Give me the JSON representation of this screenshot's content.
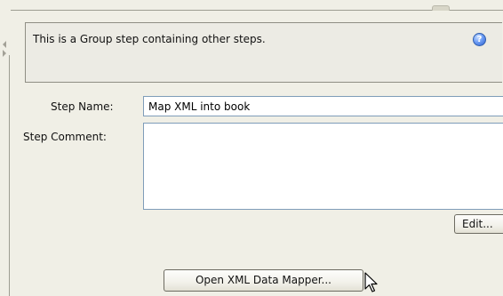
{
  "info_box": {
    "text": "This is a Group step containing other steps.",
    "help_icon_glyph": "?"
  },
  "form": {
    "step_name_label": "Step Name:",
    "step_name_value": "Map XML into book",
    "step_comment_label": "Step Comment:",
    "step_comment_value": ""
  },
  "buttons": {
    "edit_label": "Edit...",
    "open_mapper_label": "Open XML Data Mapper..."
  },
  "icons": {
    "help": "help-icon",
    "collapse_left": "arrow-left-icon",
    "expand_right": "arrow-right-icon",
    "cursor": "mouse-pointer-icon"
  },
  "colors": {
    "background": "#f0efe6",
    "info_box": "#ecebe4",
    "help_icon": "#2c5fcf",
    "input_border": "#7f9db9"
  }
}
